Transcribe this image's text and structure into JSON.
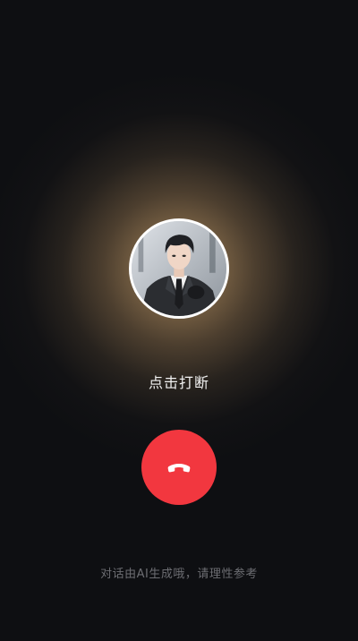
{
  "call": {
    "contact_avatar_alt": "AI character avatar",
    "hint_text": "点击打断",
    "hangup_icon": "phone-hangup-icon",
    "disclaimer": "对话由AI生成哦，请理性参考"
  },
  "colors": {
    "background": "#0e0f12",
    "glow": "#b29268",
    "hangup_button": "#f2373f",
    "hint_text": "#f2f2f2",
    "disclaimer_text": "#6c6d72"
  }
}
